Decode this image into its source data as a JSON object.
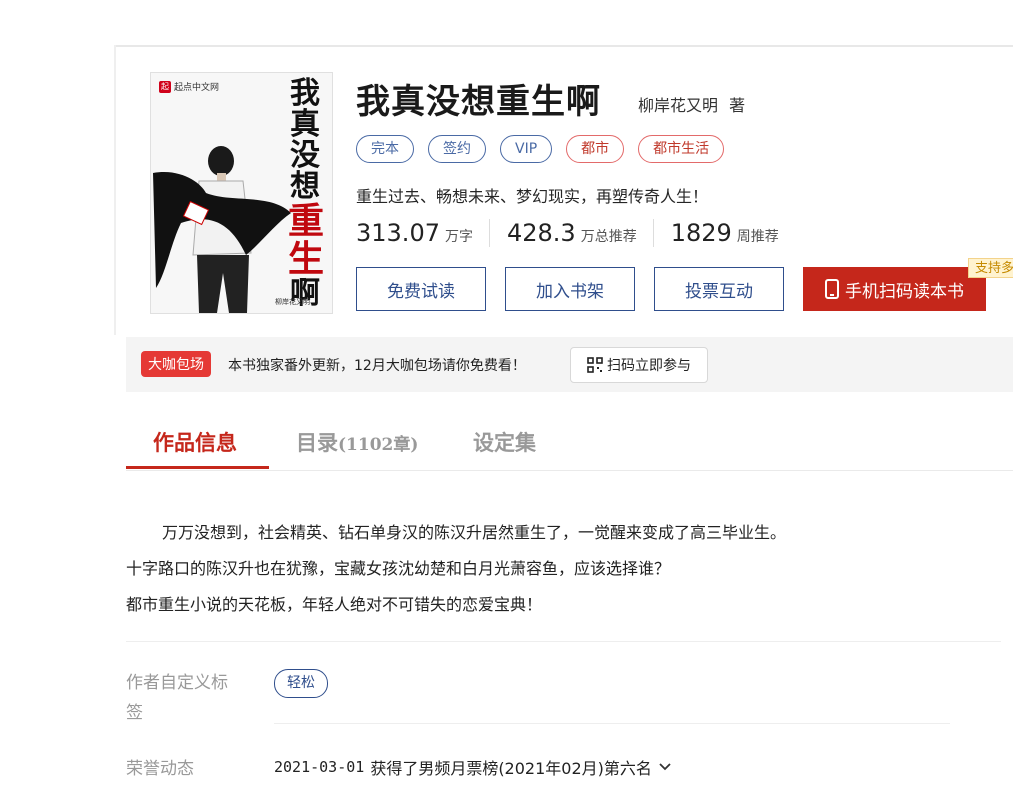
{
  "book": {
    "title": "我真没想重生啊",
    "author": "柳岸花又明",
    "author_suffix": "著",
    "tags": [
      {
        "label": "完本",
        "style": "blue"
      },
      {
        "label": "签约",
        "style": "blue"
      },
      {
        "label": "VIP",
        "style": "blue"
      },
      {
        "label": "都市",
        "style": "red"
      },
      {
        "label": "都市生活",
        "style": "red"
      }
    ],
    "intro": "重生过去、畅想未来、梦幻现实，再塑传奇人生！",
    "stats": [
      {
        "value": "313.07",
        "unit": "万字"
      },
      {
        "value": "428.3",
        "unit": "万总推荐"
      },
      {
        "value": "1829",
        "unit": "周推荐"
      }
    ]
  },
  "cover": {
    "logo_text": "起点中文网",
    "logo_mark": "起",
    "vertical_title_top": [
      "我",
      "真",
      "没",
      "想"
    ],
    "vertical_title_red": [
      "重",
      "生"
    ],
    "vertical_title_bottom": [
      "啊"
    ],
    "author": "柳岸花又明"
  },
  "actions": {
    "free_read": "免费试读",
    "add_shelf": "加入书架",
    "vote": "投票互动",
    "mobile_read": "手机扫码读本书",
    "support_badge": "支持多"
  },
  "promo": {
    "badge": "大咖包场",
    "text": "本书独家番外更新，12月大咖包场请你免费看！",
    "button": "扫码立即参与"
  },
  "tabs": {
    "info": "作品信息",
    "catalog": "目录",
    "catalog_count": "(1102章)",
    "settings": "设定集"
  },
  "description": [
    "万万没想到，社会精英、钻石单身汉的陈汉升居然重生了，一觉醒来变成了高三毕业生。",
    "十字路口的陈汉升也在犹豫，宝藏女孩沈幼楚和白月光萧容鱼，应该选择谁？",
    "都市重生小说的天花板，年轻人绝对不可错失的恋爱宝典！"
  ],
  "custom_tags": {
    "label": "作者自定义标签",
    "tags": [
      "轻松"
    ]
  },
  "honors": {
    "label": "荣誉动态",
    "date": "2021-03-01",
    "text": "获得了男频月票榜(2021年02月)第六名"
  },
  "colors": {
    "accent_red": "#c5271b",
    "accent_blue": "#2f4e8c"
  }
}
